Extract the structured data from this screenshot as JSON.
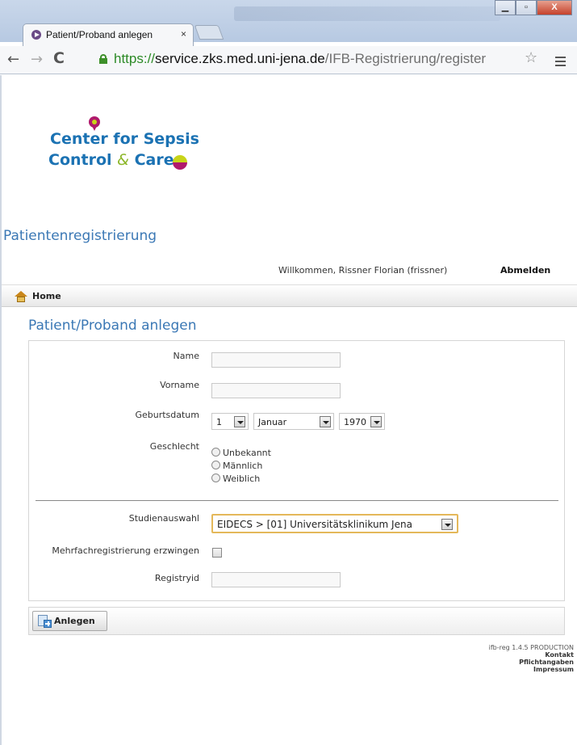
{
  "browser": {
    "tab_title": "Patient/Proband anlegen",
    "tab_close": "×",
    "url_scheme": "https://",
    "url_host": "service.zks.med.uni-jena.de",
    "url_path": "/IFB-Registrierung/register",
    "window_minimize": "▁",
    "window_maximize": "▫",
    "window_close": "X"
  },
  "logo": {
    "line1": "Center for Sepsis",
    "line2_a": "Control ",
    "line2_amp": "&",
    "line2_b": " Care"
  },
  "header": {
    "app_title": "Patientenregistrierung",
    "welcome": "Willkommen, Rissner Florian (frissner)",
    "logout": "Abmelden"
  },
  "nav": {
    "home": "Home"
  },
  "form": {
    "title": "Patient/Proband anlegen",
    "name_label": "Name",
    "name_value": "",
    "firstname_label": "Vorname",
    "firstname_value": "",
    "birthdate_label": "Geburtsdatum",
    "birth_day": "1",
    "birth_month": "Januar",
    "birth_year": "1970",
    "gender_label": "Geschlecht",
    "gender_options": [
      "Unbekannt",
      "Männlich",
      "Weiblich"
    ],
    "study_label": "Studienauswahl",
    "study_value": "EIDECS > [01] Universitätsklinikum Jena",
    "force_label": "Mehrfachregistrierung erzwingen",
    "force_checked": false,
    "registry_label": "Registryid",
    "registry_value": ""
  },
  "actions": {
    "create": "Anlegen"
  },
  "footer": {
    "version": "ifb-reg  1.4.5  PRODUCTION",
    "contact": "Kontakt",
    "mandatory": "Pflichtangaben",
    "imprint": "Impressum"
  },
  "colors": {
    "accent_blue": "#3b78b5",
    "logo_blue": "#1b72b3",
    "logo_green": "#8db72a",
    "logo_magenta": "#b0196c",
    "study_highlight": "#e4b85a"
  }
}
